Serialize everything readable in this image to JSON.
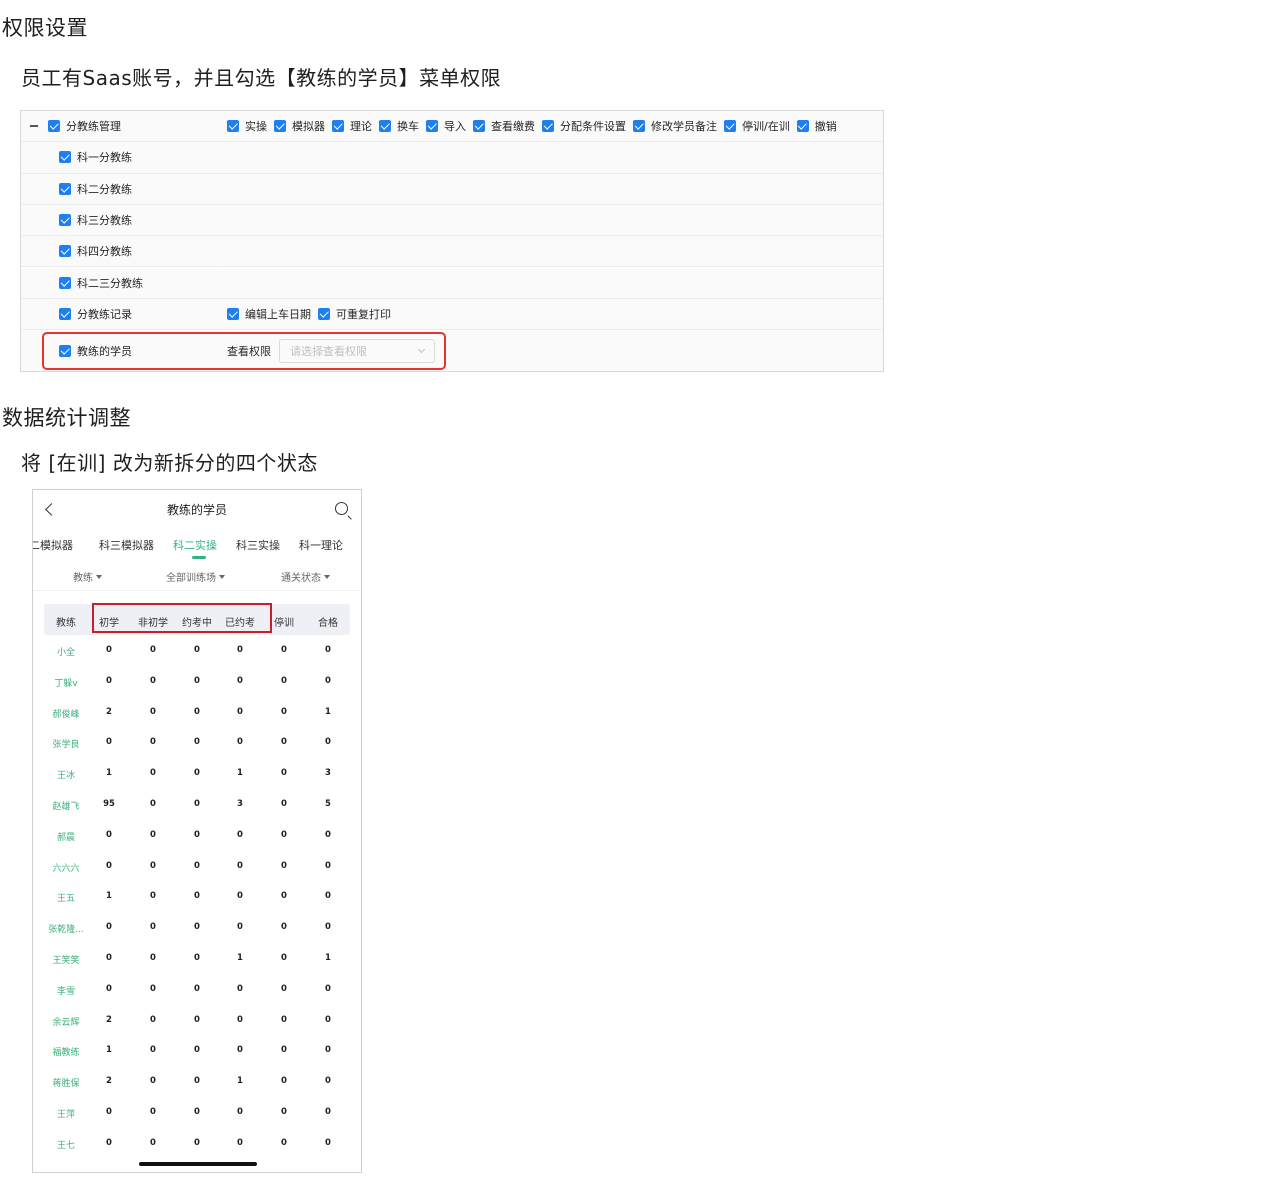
{
  "section1_title": "权限设置",
  "section1_desc": "员工有Saas账号，并且勾选【教练的学员】菜单权限",
  "permission_table": {
    "rows": [
      {
        "label": "分教练管理",
        "is_parent": true,
        "options": [
          "实操",
          "模拟器",
          "理论",
          "换车",
          "导入",
          "查看缴费",
          "分配条件设置",
          "修改学员备注",
          "停训/在训",
          "撤销"
        ]
      },
      {
        "label": "科一分教练",
        "options": []
      },
      {
        "label": "科二分教练",
        "options": []
      },
      {
        "label": "科三分教练",
        "options": []
      },
      {
        "label": "科四分教练",
        "options": []
      },
      {
        "label": "科二三分教练",
        "options": []
      },
      {
        "label": "分教练记录",
        "options": [
          "编辑上车日期",
          "可重复打印"
        ]
      }
    ],
    "last_row": {
      "label": "教练的学员",
      "select_label": "查看权限",
      "select_placeholder": "请选择查看权限"
    }
  },
  "section2_title": "数据统计调整",
  "section2_desc": "将 [在训] 改为新拆分的四个状态",
  "phone": {
    "title": "教练的学员",
    "tabs": [
      "二模拟器",
      "科三模拟器",
      "科二实操",
      "科三实操",
      "科一理论"
    ],
    "active_tab": "科二实操",
    "filters": [
      "教练",
      "全部训练场",
      "通关状态"
    ],
    "table_headers": [
      "教练",
      "初学",
      "非初学",
      "约考中",
      "已约考",
      "停训",
      "合格"
    ],
    "rows": [
      [
        "小全",
        "0",
        "0",
        "0",
        "0",
        "0",
        "0"
      ],
      [
        "丁躲v",
        "0",
        "0",
        "0",
        "0",
        "0",
        "0"
      ],
      [
        "郝俊峰",
        "2",
        "0",
        "0",
        "0",
        "0",
        "1"
      ],
      [
        "张学良",
        "0",
        "0",
        "0",
        "0",
        "0",
        "0"
      ],
      [
        "王冰",
        "1",
        "0",
        "0",
        "1",
        "0",
        "3"
      ],
      [
        "赵雄飞",
        "95",
        "0",
        "0",
        "3",
        "0",
        "5"
      ],
      [
        "郝晨",
        "0",
        "0",
        "0",
        "0",
        "0",
        "0"
      ],
      [
        "六六六",
        "0",
        "0",
        "0",
        "0",
        "0",
        "0"
      ],
      [
        "王五",
        "1",
        "0",
        "0",
        "0",
        "0",
        "0"
      ],
      [
        "张乾隆...",
        "0",
        "0",
        "0",
        "0",
        "0",
        "0"
      ],
      [
        "王笑笑",
        "0",
        "0",
        "0",
        "1",
        "0",
        "1"
      ],
      [
        "李雪",
        "0",
        "0",
        "0",
        "0",
        "0",
        "0"
      ],
      [
        "余云辉",
        "2",
        "0",
        "0",
        "0",
        "0",
        "0"
      ],
      [
        "福教练",
        "1",
        "0",
        "0",
        "0",
        "0",
        "0"
      ],
      [
        "蒋胜保",
        "2",
        "0",
        "0",
        "1",
        "0",
        "0"
      ],
      [
        "王萍",
        "0",
        "0",
        "0",
        "0",
        "0",
        "0"
      ],
      [
        "王七",
        "0",
        "0",
        "0",
        "0",
        "0",
        "0"
      ]
    ]
  },
  "colors": {
    "checkbox_blue": "#1e7ff0",
    "highlight_red": "#e8322e",
    "accent_green": "#2fb57f"
  }
}
